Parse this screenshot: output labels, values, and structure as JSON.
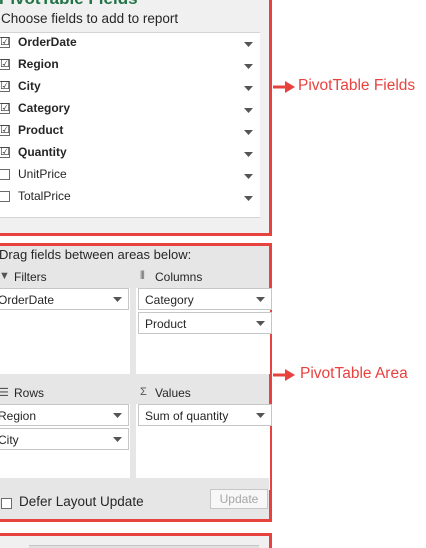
{
  "fields_pane": {
    "title": "PivotTable Fields",
    "choose_label": "Choose fields to add to report",
    "fields": [
      {
        "label": "OrderDate",
        "checked": true,
        "check_mark": "☑"
      },
      {
        "label": "Region",
        "checked": true,
        "check_mark": "☑"
      },
      {
        "label": "City",
        "checked": true,
        "check_mark": "☑"
      },
      {
        "label": "Category",
        "checked": true,
        "check_mark": "☑"
      },
      {
        "label": "Product",
        "checked": true,
        "check_mark": "☑"
      },
      {
        "label": "Quantity",
        "checked": true,
        "check_mark": "☑"
      },
      {
        "label": "UnitPrice",
        "checked": false,
        "check_mark": ""
      },
      {
        "label": "TotalPrice",
        "checked": false,
        "check_mark": ""
      }
    ]
  },
  "areas_pane": {
    "drag_label": "Drag fields between areas below:",
    "filters": {
      "title": "Filters",
      "icon": "filter-icon",
      "items": [
        "OrderDate"
      ]
    },
    "columns": {
      "title": "Columns",
      "icon": "columns-icon",
      "items": [
        "Category",
        "Product"
      ]
    },
    "rows": {
      "title": "Rows",
      "icon": "rows-icon",
      "items": [
        "Region",
        "City"
      ]
    },
    "values": {
      "title": "Values",
      "icon": "sigma-icon",
      "items": [
        "Sum of quantity"
      ]
    },
    "defer_label": "Defer Layout Update",
    "update_label": "Update"
  },
  "annotations": {
    "fields": "PivotTable Fields",
    "area": "PivotTable Area"
  },
  "colors": {
    "annotation_red": "#e8423f",
    "title_green": "#217346",
    "panel_gray": "#f0f0f0",
    "area_gray": "#e6e6e6"
  }
}
